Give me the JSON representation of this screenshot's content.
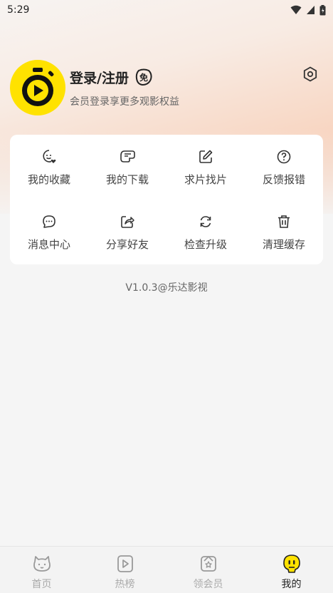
{
  "status_bar": {
    "time": "5:29"
  },
  "profile": {
    "title": "登录/注册",
    "badge": "免",
    "subtitle": "会员登录享更多观影权益"
  },
  "menu": [
    {
      "label": "我的收藏",
      "icon": "favorites-icon"
    },
    {
      "label": "我的下载",
      "icon": "download-icon"
    },
    {
      "label": "求片找片",
      "icon": "edit-icon"
    },
    {
      "label": "反馈报错",
      "icon": "question-icon"
    },
    {
      "label": "消息中心",
      "icon": "message-icon"
    },
    {
      "label": "分享好友",
      "icon": "share-icon"
    },
    {
      "label": "检查升级",
      "icon": "refresh-icon"
    },
    {
      "label": "清理缓存",
      "icon": "trash-icon"
    }
  ],
  "version": "V1.0.3@乐达影视",
  "tabs": [
    {
      "label": "首页",
      "icon": "home-icon"
    },
    {
      "label": "热榜",
      "icon": "hot-list-icon"
    },
    {
      "label": "领会员",
      "icon": "vip-icon"
    },
    {
      "label": "我的",
      "icon": "mine-icon",
      "active": true
    }
  ],
  "colors": {
    "accent": "#ffe200",
    "avatar_bg": "#ffe200",
    "gradient_end": "#f6c3a8"
  }
}
